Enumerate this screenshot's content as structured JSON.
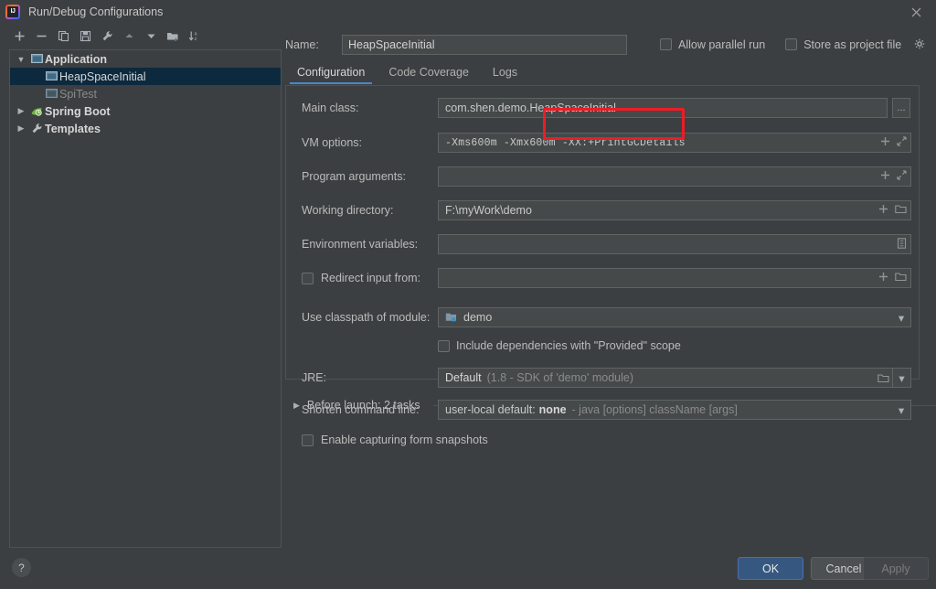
{
  "window": {
    "title": "Run/Debug Configurations",
    "app_icon": "intellij-idea-logo",
    "close_icon": "close-icon"
  },
  "toolbar": {
    "buttons": [
      {
        "name": "add-configuration",
        "icon": "plus-icon"
      },
      {
        "name": "remove-configuration",
        "icon": "minus-icon"
      },
      {
        "name": "copy-configuration",
        "icon": "copy-icon"
      },
      {
        "name": "save-configuration",
        "icon": "save-icon"
      },
      {
        "name": "edit-templates",
        "icon": "wrench-icon"
      },
      {
        "name": "move-up",
        "icon": "arrow-up-icon"
      },
      {
        "name": "move-down",
        "icon": "arrow-down-icon"
      },
      {
        "name": "new-folder",
        "icon": "new-folder-icon"
      },
      {
        "name": "sort-configurations",
        "icon": "sort-alpha-icon"
      }
    ]
  },
  "tree": {
    "nodes": [
      {
        "label": "Application",
        "icon": "application-icon",
        "level": 0,
        "expanded": true,
        "selected": false,
        "style": "bold"
      },
      {
        "label": "HeapSpaceInitial",
        "icon": "application-icon",
        "level": 1,
        "expanded": null,
        "selected": true,
        "style": "selected"
      },
      {
        "label": "SpiTest",
        "icon": "application-icon",
        "level": 1,
        "expanded": null,
        "selected": false,
        "style": "dim"
      },
      {
        "label": "Spring Boot",
        "icon": "spring-boot-icon",
        "level": 0,
        "expanded": false,
        "selected": false,
        "style": "bold"
      },
      {
        "label": "Templates",
        "icon": "wrench-icon",
        "level": 0,
        "expanded": false,
        "selected": false,
        "style": "bold"
      }
    ]
  },
  "header": {
    "name_label": "Name:",
    "name_value": "HeapSpaceInitial",
    "allow_parallel_run": {
      "label": "Allow parallel run",
      "checked": false
    },
    "store_as_project_file": {
      "label": "Store as project file",
      "checked": false
    },
    "gear_icon": "gear-icon"
  },
  "tabs": [
    {
      "label": "Configuration",
      "active": true
    },
    {
      "label": "Code Coverage",
      "active": false
    },
    {
      "label": "Logs",
      "active": false
    }
  ],
  "form": {
    "main_class": {
      "label": "Main class:",
      "value": "com.shen.demo.HeapSpaceInitial",
      "browse_label": "..."
    },
    "vm_options": {
      "label": "VM options:",
      "value": "-Xms600m -Xmx600m -XX:+PrintGCDetails"
    },
    "program_arguments": {
      "label": "Program arguments:",
      "value": ""
    },
    "working_directory": {
      "label": "Working directory:",
      "value": "F:\\myWork\\demo"
    },
    "environment_vars": {
      "label": "Environment variables:",
      "value": ""
    },
    "redirect_input": {
      "label": "Redirect input from:",
      "value": "",
      "checked": false
    },
    "classpath_module": {
      "label": "Use classpath of module:",
      "value": "demo",
      "icon": "module-icon"
    },
    "include_provided": {
      "label": "Include dependencies with \"Provided\" scope",
      "checked": false
    },
    "jre": {
      "label": "JRE:",
      "value": "Default",
      "value_hint": "(1.8 - SDK of 'demo' module)"
    },
    "shorten_cmdline": {
      "label": "Shorten command line:",
      "value_prefix": "user-local default:",
      "value_strong": "none",
      "value_hint": "- java [options] className [args]"
    },
    "form_snapshots": {
      "label": "Enable capturing form snapshots",
      "checked": false
    },
    "before_launch": {
      "label": "Before launch: 2 tasks"
    }
  },
  "annotation": {
    "color": "#ee1c25",
    "covers": "-XX:+PrintGCDetails"
  },
  "footer": {
    "help_label": "?",
    "ok_label": "OK",
    "cancel_label": "Cancel",
    "apply_label": "Apply",
    "ok_color": "#365880"
  }
}
